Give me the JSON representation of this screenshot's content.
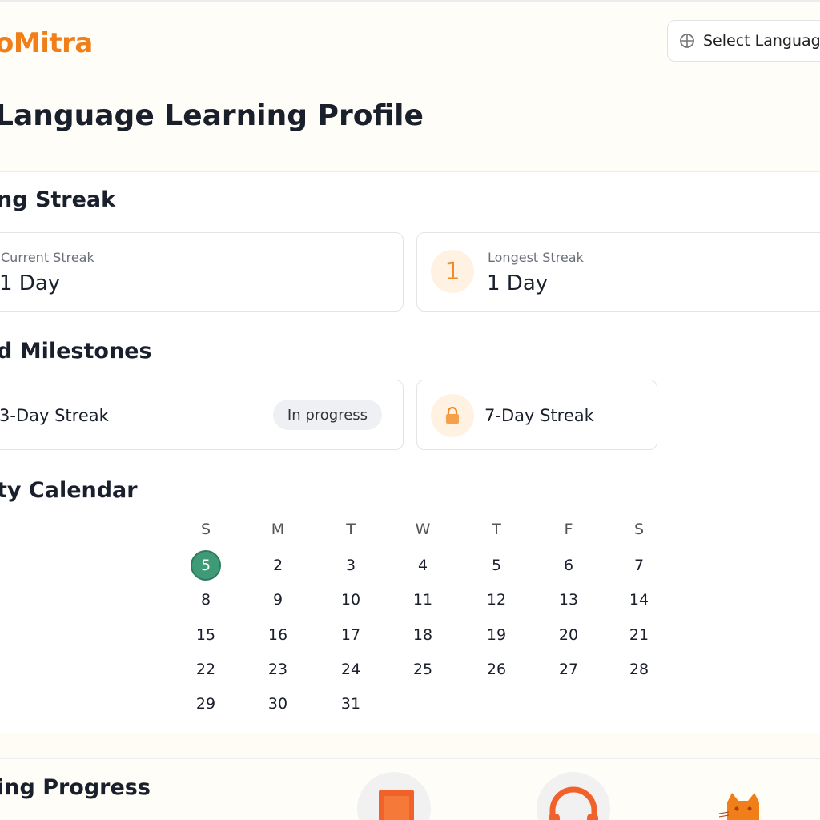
{
  "header": {
    "logo_text": "oMitra",
    "language_button_label": "Select Languag",
    "globe_icon": "globe-icon"
  },
  "page": {
    "title": "Language Learning Profile"
  },
  "streak": {
    "section_title": "ng Streak",
    "current": {
      "label": "Current Streak",
      "value": "1 Day"
    },
    "longest": {
      "label": "Longest Streak",
      "value": "1 Day",
      "badge": "1"
    }
  },
  "milestones": {
    "section_title": "d Milestones",
    "items": [
      {
        "name": "3-Day Streak",
        "status": "In progress"
      },
      {
        "name": "7-Day Streak",
        "icon": "lock-icon"
      }
    ]
  },
  "calendar": {
    "section_title": "ty Calendar",
    "weekdays": [
      "S",
      "M",
      "T",
      "W",
      "T",
      "F",
      "S"
    ],
    "weeks": [
      [
        "5",
        "2",
        "3",
        "4",
        "5",
        "6",
        "7"
      ],
      [
        "8",
        "9",
        "10",
        "11",
        "12",
        "13",
        "14"
      ],
      [
        "15",
        "16",
        "17",
        "18",
        "19",
        "20",
        "21"
      ],
      [
        "22",
        "23",
        "24",
        "25",
        "26",
        "27",
        "28"
      ],
      [
        "29",
        "30",
        "31"
      ]
    ]
  },
  "progress": {
    "section_title": "ing Progress",
    "icons": [
      "book-icon",
      "headphones-icon",
      "cat-mascot-icon"
    ]
  },
  "colors": {
    "brand": "#f07f1a",
    "today": "#3f9a78"
  }
}
